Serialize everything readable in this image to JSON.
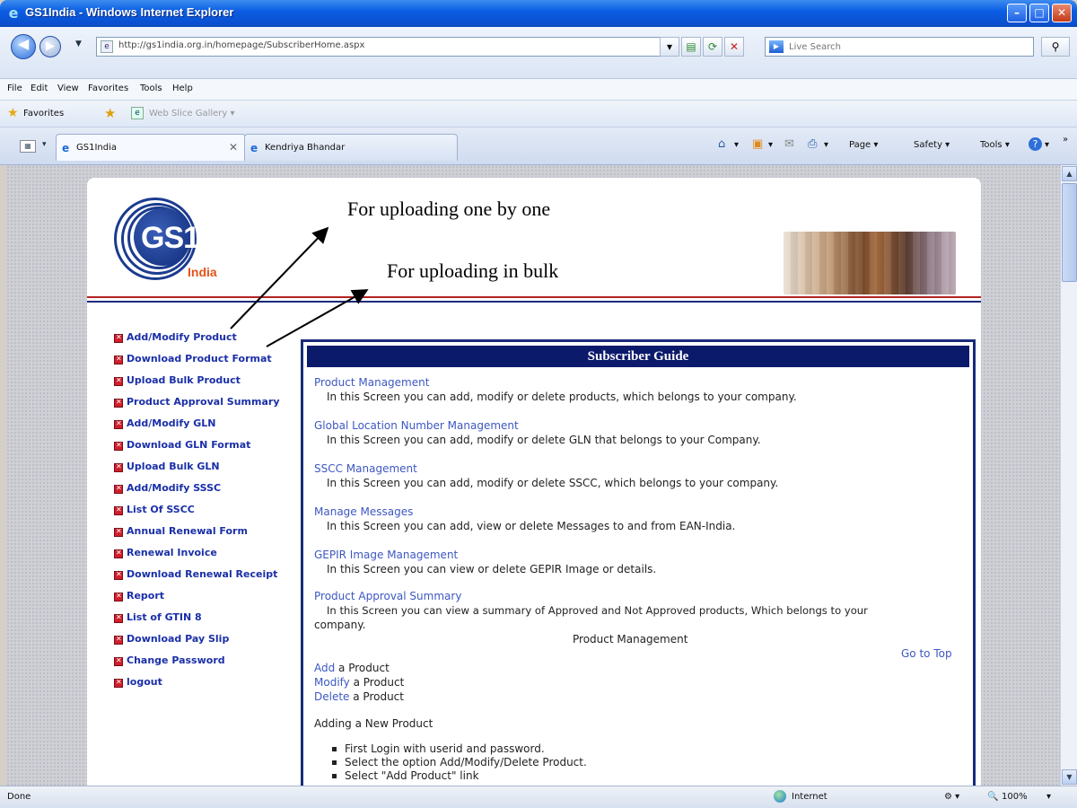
{
  "window": {
    "title": "GS1India - Windows Internet Explorer",
    "min_glyph": "–",
    "max_glyph": "□",
    "close_glyph": "✕"
  },
  "nav": {
    "back_glyph": "◀",
    "forward_glyph": "▶",
    "dropdown_glyph": "▼",
    "url": "http://gs1india.org.in/homepage/SubscriberHome.aspx",
    "search_placeholder": "Live Search",
    "search_go_glyph": "⚲"
  },
  "menu": [
    "File",
    "Edit",
    "View",
    "Favorites",
    "Tools",
    "Help"
  ],
  "favorites": {
    "label": "Favorites",
    "gallery": "Web Slice Gallery ▾"
  },
  "tabs": [
    {
      "label": "GS1India",
      "close_glyph": "✕"
    },
    {
      "label": "Kendriya Bhandar"
    }
  ],
  "commands": {
    "page": "Page ▾",
    "safety": "Safety ▾",
    "tools": "Tools ▾",
    "help_glyph": "?"
  },
  "logo": {
    "brand": "GS1",
    "country": "India"
  },
  "annotations": {
    "one_by_one": "For uploading one by one",
    "bulk": "For uploading in bulk"
  },
  "left_menu": [
    "Add/Modify Product",
    "Download Product Format",
    "Upload Bulk Product",
    "Product Approval Summary",
    "Add/Modify GLN",
    "Download GLN Format",
    "Upload Bulk GLN",
    "Add/Modify SSSC",
    "List Of SSCC",
    "Annual Renewal Form",
    "Renewal Invoice",
    "Download Renewal Receipt",
    "Report",
    "List of GTIN 8",
    "Download Pay Slip",
    "Change Password",
    "logout"
  ],
  "guide": {
    "title": "Subscriber Guide",
    "sections": [
      {
        "link": "Product Management",
        "desc": "In this Screen you can add, modify or delete products, which belongs to your company."
      },
      {
        "link": "Global Location Number Management",
        "desc": "In this Screen you can add, modify or delete GLN that belongs to your Company."
      },
      {
        "link": "SSCC Management",
        "desc": "In this Screen you can add, modify or delete SSCC, which belongs to your company."
      },
      {
        "link": "Manage Messages",
        "desc": "In this Screen you can add, view or delete Messages to and from EAN-India."
      },
      {
        "link": "GEPIR Image Management",
        "desc": "In this Screen you can view or delete GEPIR Image or details."
      },
      {
        "link": "Product Approval Summary",
        "desc": "In this Screen you can view a summary of Approved and Not Approved products, Which belongs to your",
        "desc2": "company."
      }
    ],
    "subheading": "Product Management",
    "go_to_top": "Go to Top",
    "actions": [
      {
        "link": "Add",
        "rest": " a Product"
      },
      {
        "link": "Modify",
        "rest": " a Product"
      },
      {
        "link": "Delete",
        "rest": " a Product"
      }
    ],
    "adding_heading": "Adding a New Product",
    "steps": [
      "First Login with userid and password.",
      "Select the option Add/Modify/Delete Product.",
      "Select \"Add Product\" link"
    ]
  },
  "status": {
    "left": "Done",
    "zone": "Internet",
    "zoom": "100%"
  }
}
